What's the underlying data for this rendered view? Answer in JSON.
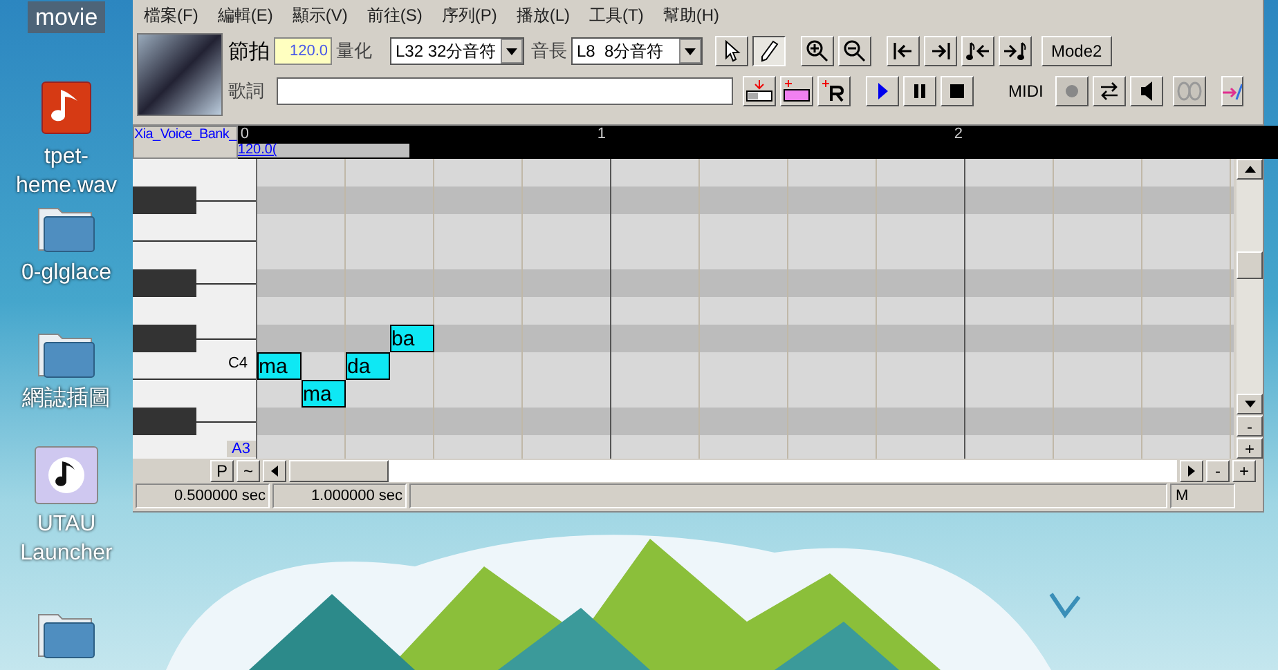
{
  "desktop": {
    "label": "movie",
    "icons": [
      {
        "kind": "audio",
        "lines": [
          "tpet-",
          "heme.wav"
        ]
      },
      {
        "kind": "folder",
        "lines": [
          "0-glglace"
        ]
      },
      {
        "kind": "folder",
        "lines": [
          "網誌插圖"
        ]
      },
      {
        "kind": "app",
        "lines": [
          "UTAU",
          "Launcher"
        ]
      },
      {
        "kind": "folder"
      }
    ]
  },
  "menu": [
    "檔案(F)",
    "編輯(E)",
    "顯示(V)",
    "前往(S)",
    "序列(P)",
    "播放(L)",
    "工具(T)",
    "幫助(H)"
  ],
  "toolbar": {
    "tempo_label": "節拍",
    "tempo": "120.0",
    "quantize_label": "量化",
    "quantize": "L32 32分音符",
    "length_label": "音長",
    "length": "L8  8分音符",
    "tools": [
      {
        "kind": "pointer",
        "selected": false
      },
      {
        "kind": "pencil",
        "selected": true
      }
    ],
    "mode_button": "Mode2",
    "lyric_label": "歌詞",
    "midi_label": "MIDI"
  },
  "track": {
    "name": "Xia_Voice_Bank_",
    "tempo": "120.0(",
    "measures": [
      "0",
      "1",
      "2"
    ]
  },
  "keys": [
    {
      "kind": "white"
    },
    {
      "kind": "black"
    },
    {
      "kind": "white"
    },
    {
      "kind": "white"
    },
    {
      "kind": "black"
    },
    {
      "kind": "white"
    },
    {
      "kind": "black"
    },
    {
      "kind": "white",
      "label": {
        "text": "C4",
        "highlighted": false
      }
    },
    {
      "kind": "white"
    },
    {
      "kind": "black"
    },
    {
      "kind": "white",
      "label": {
        "text": "A3",
        "highlighted": true
      }
    }
  ],
  "notes": [
    {
      "lyric": "ma"
    },
    {
      "lyric": "ma"
    },
    {
      "lyric": "da"
    },
    {
      "lyric": "ba"
    }
  ],
  "vscroll": {
    "buttons": [
      "-",
      "+"
    ]
  },
  "hscroll": {
    "buttons_left": [
      "P",
      "~"
    ],
    "buttons_right": [
      "-",
      "+"
    ]
  },
  "status": {
    "cells": [
      "0.500000 sec",
      "1.000000 sec"
    ],
    "mode": "M"
  }
}
